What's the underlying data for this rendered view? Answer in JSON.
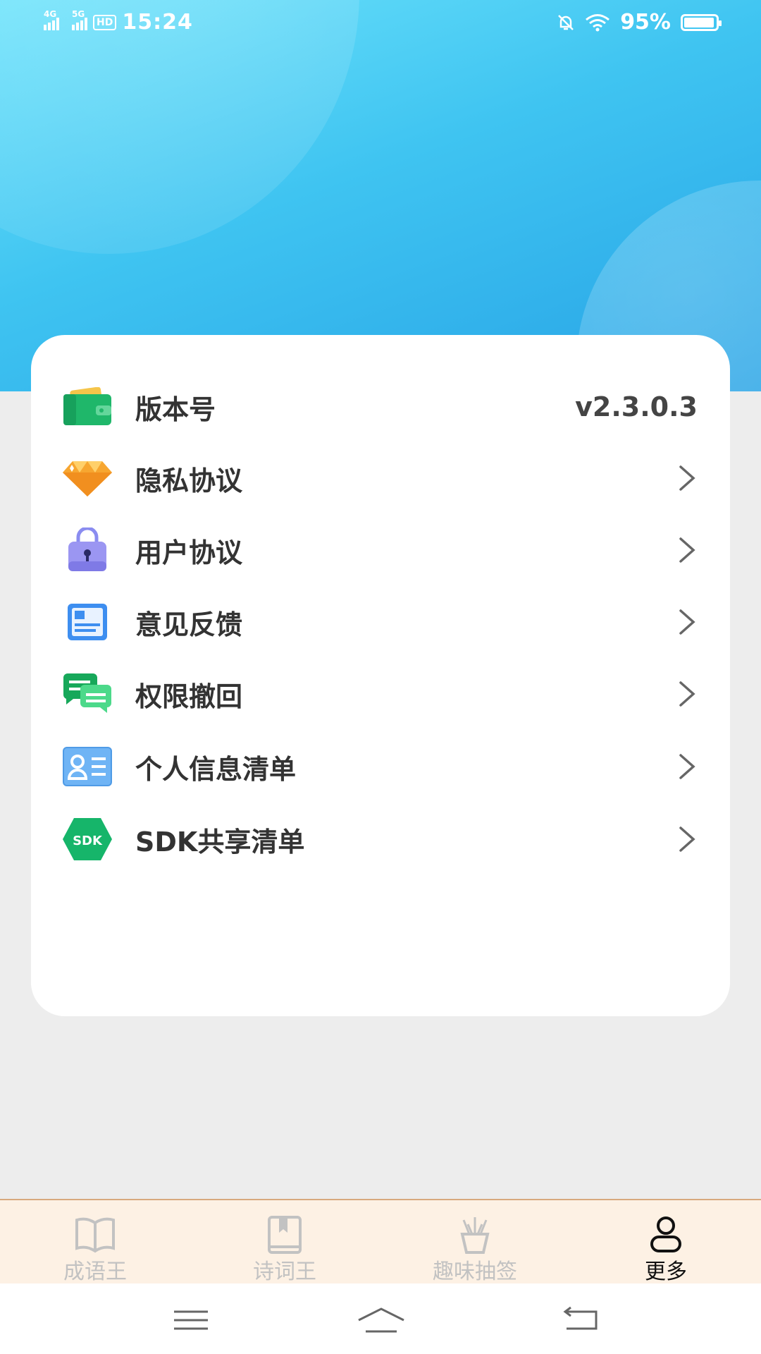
{
  "status_bar": {
    "sig1_label": "4G",
    "sig2_label": "5G",
    "hd_label": "HD",
    "time": "15:24",
    "battery_text": "95%",
    "battery_level": 0.95
  },
  "menu": {
    "items": [
      {
        "label": "版本号",
        "value": "v2.3.0.3",
        "icon": "wallet-icon"
      },
      {
        "label": "隐私协议",
        "icon": "diamond-icon"
      },
      {
        "label": "用户协议",
        "icon": "lock-bag-icon"
      },
      {
        "label": "意见反馈",
        "icon": "feedback-card-icon"
      },
      {
        "label": "权限撤回",
        "icon": "chat-bubbles-icon"
      },
      {
        "label": "个人信息清单",
        "icon": "contact-card-icon"
      },
      {
        "label": "SDK共享清单",
        "icon": "sdk-hexagon-icon",
        "badge": "SDK"
      }
    ]
  },
  "tabbar": {
    "tabs": [
      {
        "label": "成语王",
        "icon": "book-open-icon",
        "active": false
      },
      {
        "label": "诗词王",
        "icon": "bookmark-book-icon",
        "active": false
      },
      {
        "label": "趣味抽签",
        "icon": "fortune-sticks-icon",
        "active": false
      },
      {
        "label": "更多",
        "icon": "user-icon",
        "active": true
      }
    ]
  },
  "system_nav": {
    "buttons": [
      "menu-icon",
      "home-icon",
      "back-icon"
    ]
  },
  "colors": {
    "hero_top": "#6de3fb",
    "hero_bottom": "#27a3e6",
    "tabbar_bg": "#fdf1e4",
    "tab_inactive": "#c2c2c2",
    "tab_active": "#111111"
  }
}
